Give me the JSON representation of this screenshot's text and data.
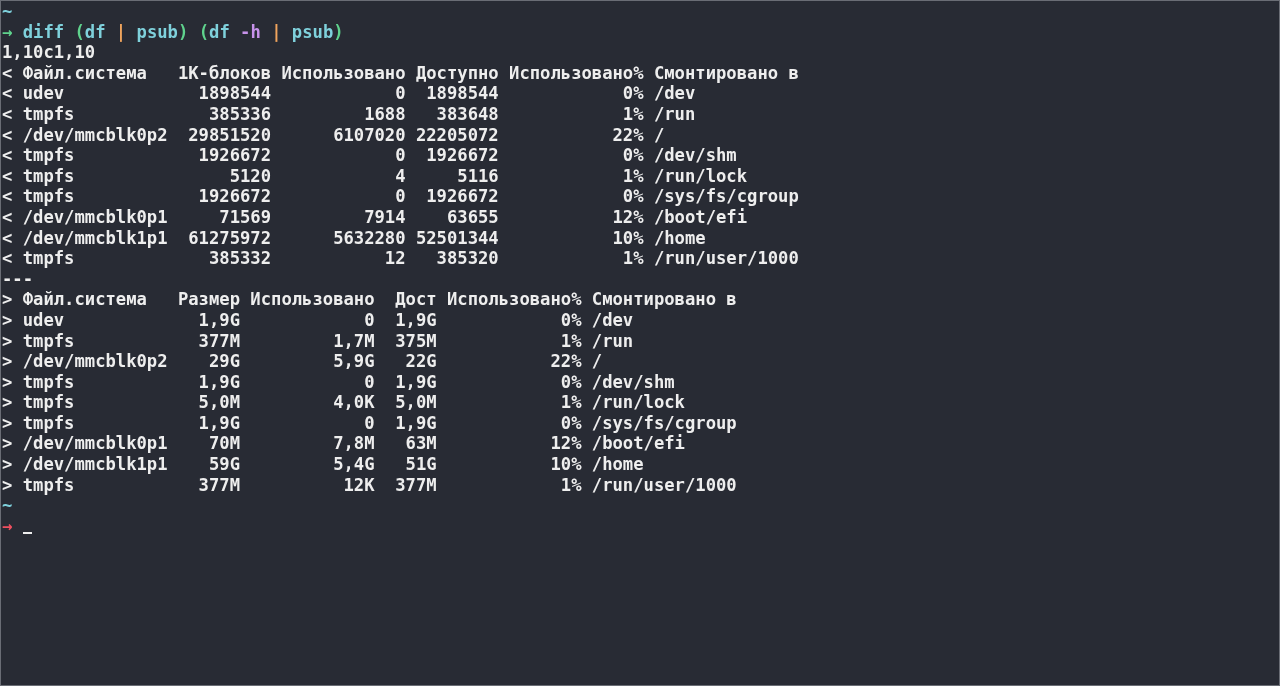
{
  "terminal": {
    "blocks": [
      {
        "kind": "prompt",
        "cwd": "~",
        "symbol": "→",
        "error": false,
        "tokens": [
          {
            "text": "diff ",
            "kind": "command"
          },
          {
            "text": "(",
            "kind": "paren"
          },
          {
            "text": "df ",
            "kind": "command"
          },
          {
            "text": "|",
            "kind": "pipe"
          },
          {
            "text": " psub",
            "kind": "command"
          },
          {
            "text": ")",
            "kind": "paren"
          },
          {
            "text": " (",
            "kind": "paren"
          },
          {
            "text": "df ",
            "kind": "command"
          },
          {
            "text": "-h ",
            "kind": "flag"
          },
          {
            "text": "|",
            "kind": "pipe"
          },
          {
            "text": " psub",
            "kind": "command"
          },
          {
            "text": ")",
            "kind": "paren"
          }
        ]
      },
      {
        "kind": "output",
        "lines": [
          "1,10c1,10",
          "< Файл.система   1K-блоков Использовано Доступно Использовано% Смонтировано в",
          "< udev             1898544            0  1898544            0% /dev",
          "< tmpfs             385336         1688   383648            1% /run",
          "< /dev/mmcblk0p2  29851520      6107020 22205072           22% /",
          "< tmpfs            1926672            0  1926672            0% /dev/shm",
          "< tmpfs               5120            4     5116            1% /run/lock",
          "< tmpfs            1926672            0  1926672            0% /sys/fs/cgroup",
          "< /dev/mmcblk0p1     71569         7914    63655           12% /boot/efi",
          "< /dev/mmcblk1p1  61275972      5632280 52501344           10% /home",
          "< tmpfs             385332           12   385320            1% /run/user/1000",
          "---",
          "> Файл.система   Размер Использовано  Дост Использовано% Смонтировано в",
          "> udev             1,9G            0  1,9G            0% /dev",
          "> tmpfs            377M         1,7M  375M            1% /run",
          "> /dev/mmcblk0p2    29G         5,9G   22G           22% /",
          "> tmpfs            1,9G            0  1,9G            0% /dev/shm",
          "> tmpfs            5,0M         4,0K  5,0M            1% /run/lock",
          "> tmpfs            1,9G            0  1,9G            0% /sys/fs/cgroup",
          "> /dev/mmcblk0p1    70M         7,8M   63M           12% /boot/efi",
          "> /dev/mmcblk1p1    59G         5,4G   51G           10% /home",
          "> tmpfs            377M          12K  377M            1% /run/user/1000"
        ]
      },
      {
        "kind": "prompt",
        "cwd": "~",
        "symbol": "→",
        "error": true,
        "cursor": true
      }
    ]
  }
}
